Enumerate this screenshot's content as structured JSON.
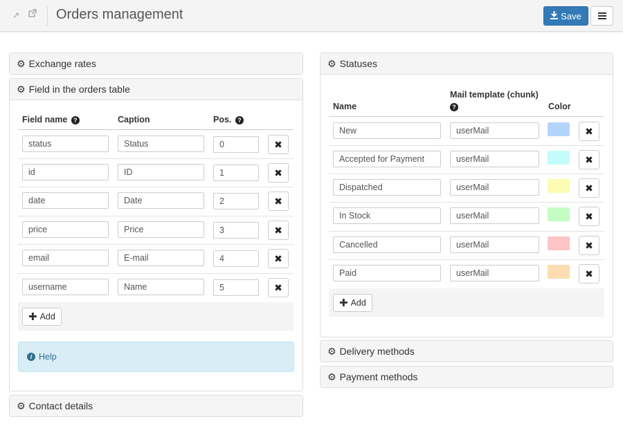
{
  "header": {
    "title": "Orders management",
    "save_label": "Save"
  },
  "left": {
    "exchange_rates": "Exchange rates",
    "fields_panel": {
      "title": "Field in the orders table",
      "columns": {
        "field_name": "Field name",
        "caption": "Caption",
        "pos": "Pos."
      },
      "rows": [
        {
          "field": "status",
          "caption": "Status",
          "pos": "0"
        },
        {
          "field": "id",
          "caption": "ID",
          "pos": "1"
        },
        {
          "field": "date",
          "caption": "Date",
          "pos": "2"
        },
        {
          "field": "price",
          "caption": "Price",
          "pos": "3"
        },
        {
          "field": "email",
          "caption": "E-mail",
          "pos": "4"
        },
        {
          "field": "username",
          "caption": "Name",
          "pos": "5"
        }
      ],
      "add_label": "Add",
      "help_label": "Help"
    },
    "contact_details": "Contact details"
  },
  "right": {
    "statuses_panel": {
      "title": "Statuses",
      "columns": {
        "name": "Name",
        "mail_template": "Mail template (chunk)",
        "color": "Color"
      },
      "rows": [
        {
          "name": "New",
          "template": "userMail",
          "color": "#b3d4fc"
        },
        {
          "name": "Accepted for Payment",
          "template": "userMail",
          "color": "#c4fcfc"
        },
        {
          "name": "Dispatched",
          "template": "userMail",
          "color": "#fcfcb3"
        },
        {
          "name": "In Stock",
          "template": "userMail",
          "color": "#c4fcc4"
        },
        {
          "name": "Cancelled",
          "template": "userMail",
          "color": "#fcc4c4"
        },
        {
          "name": "Paid",
          "template": "userMail",
          "color": "#fcdcb0"
        }
      ],
      "add_label": "Add"
    },
    "delivery_methods": "Delivery methods",
    "payment_methods": "Payment methods"
  }
}
